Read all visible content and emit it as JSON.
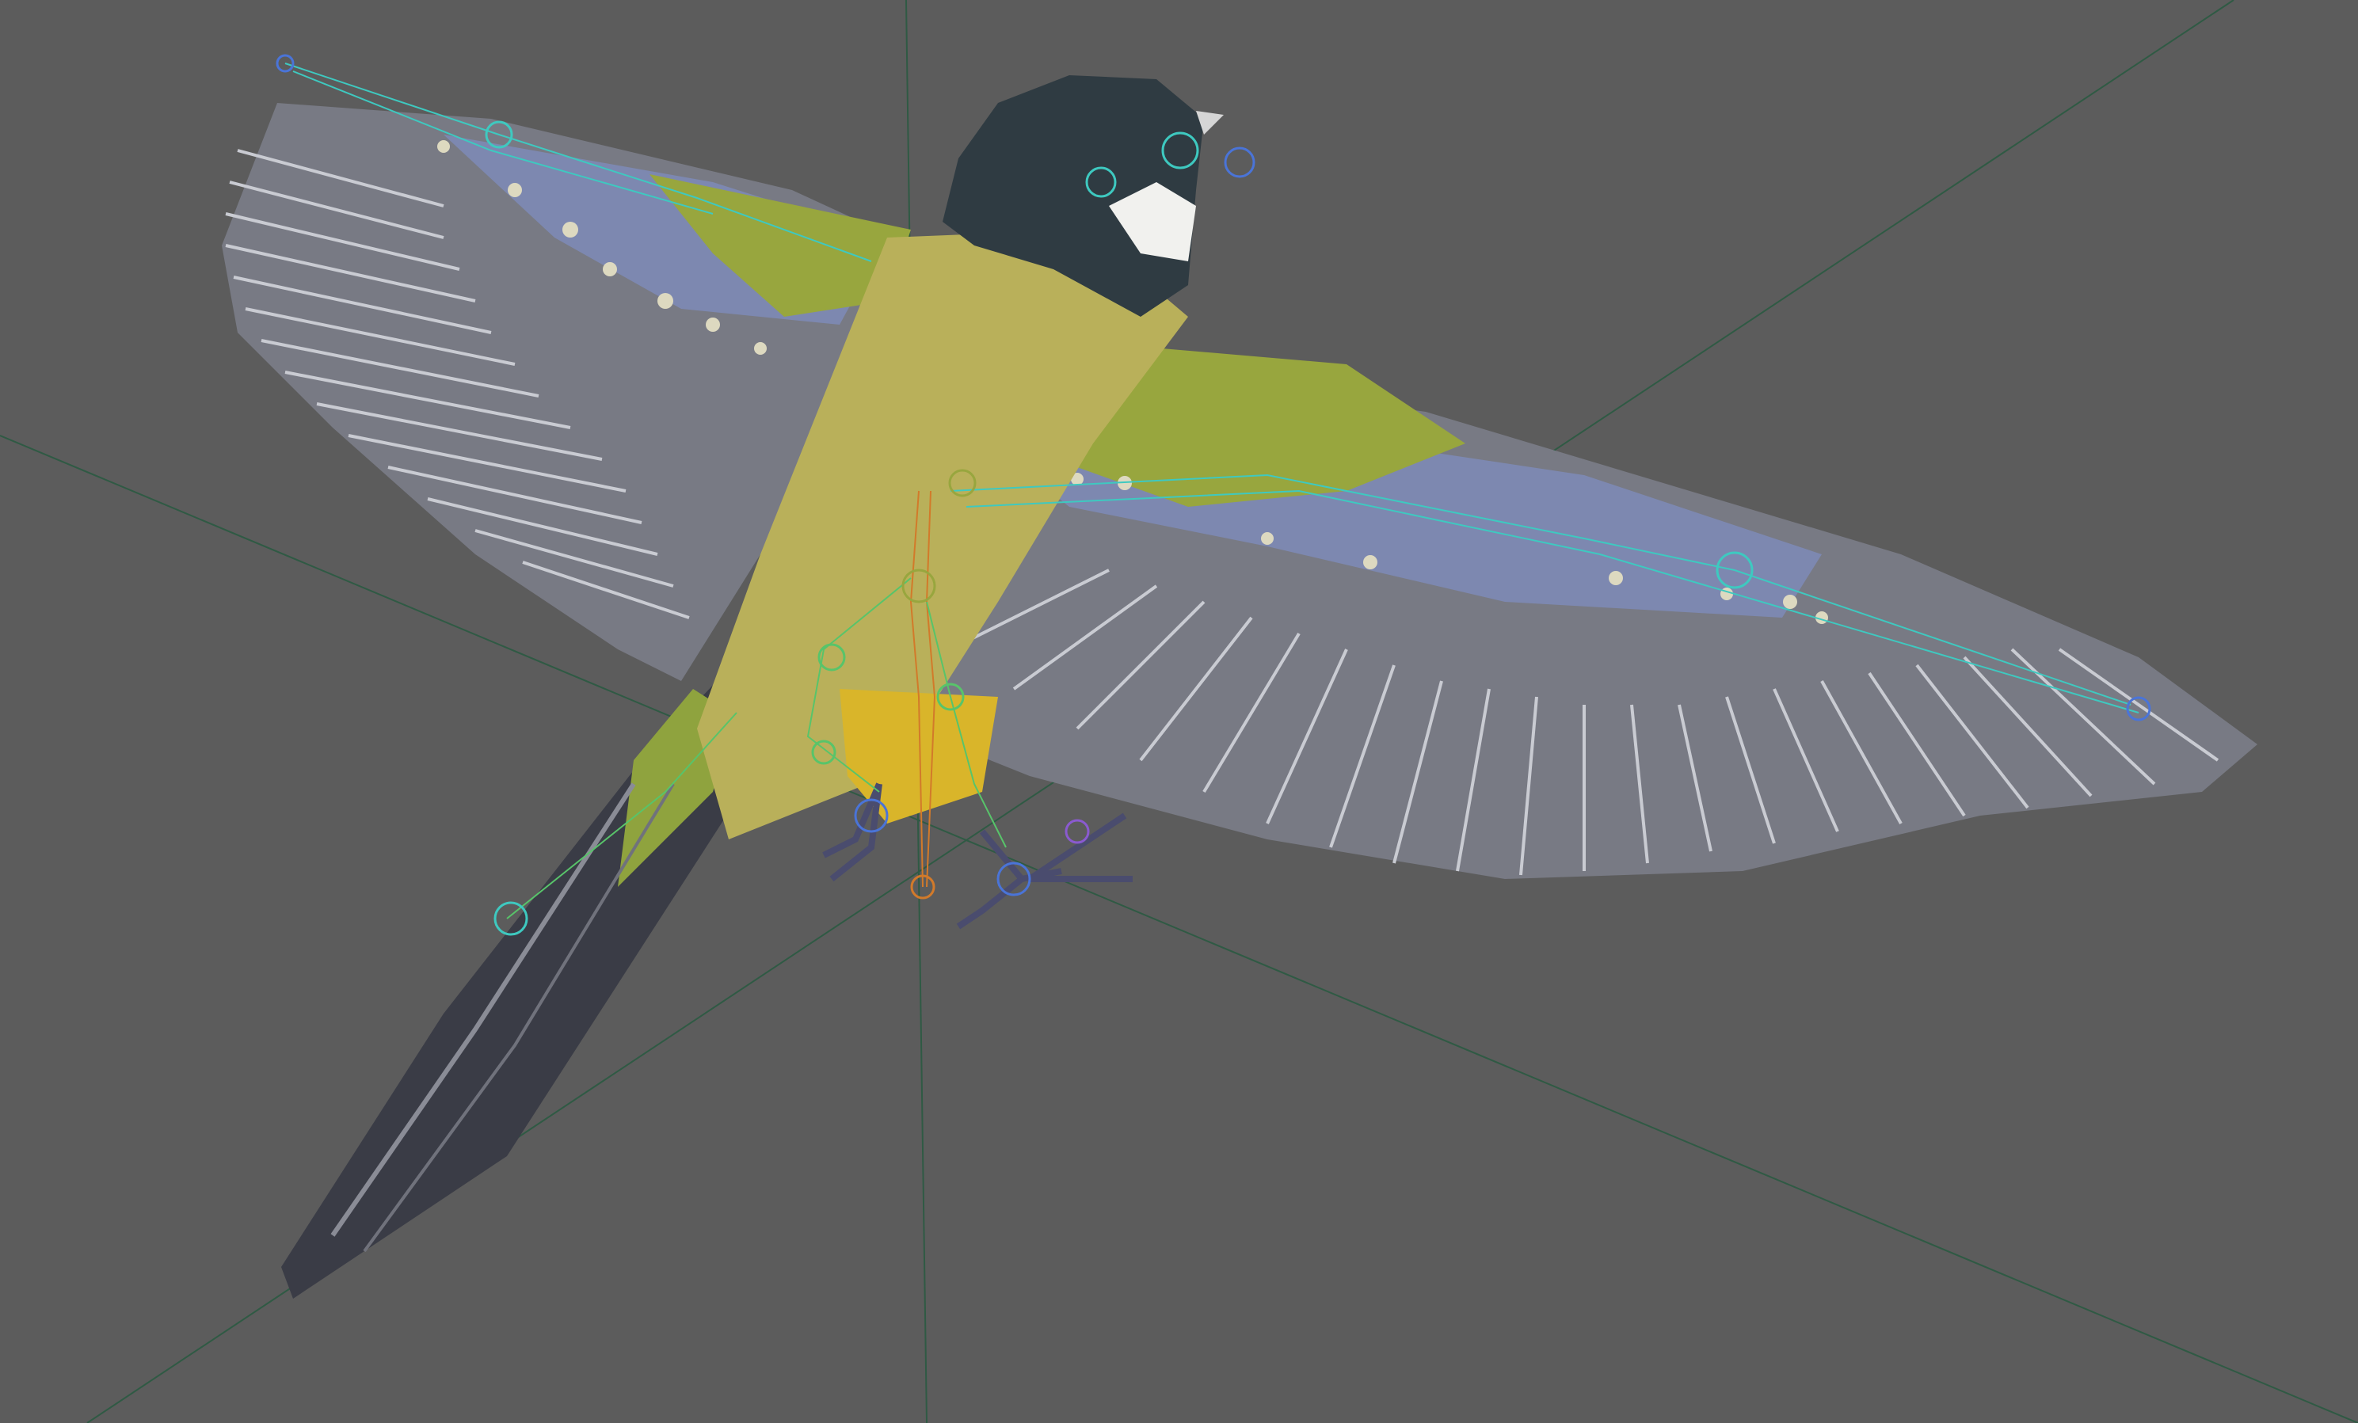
{
  "viewport": {
    "background": "#5c5c5c",
    "grid_axis_color": "#2f5a44",
    "subject": "bird-rig",
    "colors": {
      "wing_feather": "#7a7c86",
      "wing_feather_dark": "#4a4c56",
      "feather_edge": "#c9cbd2",
      "covert_green": "#98a63e",
      "covert_blue": "#7d88b0",
      "body_yellow": "#b9b05a",
      "belly_yellow": "#d9b52a",
      "head_dark": "#2f3b42",
      "cheek_white": "#f1f1ee",
      "tail_dark": "#3a3c46",
      "bone_cyan": "#3ec9c0",
      "bone_green": "#58c46a",
      "bone_orange": "#d27a2a",
      "bone_purple": "#8a5ad0",
      "bone_blue": "#4a74d8"
    },
    "icons": [
      "joint-control-icon",
      "ik-handle-icon"
    ]
  }
}
